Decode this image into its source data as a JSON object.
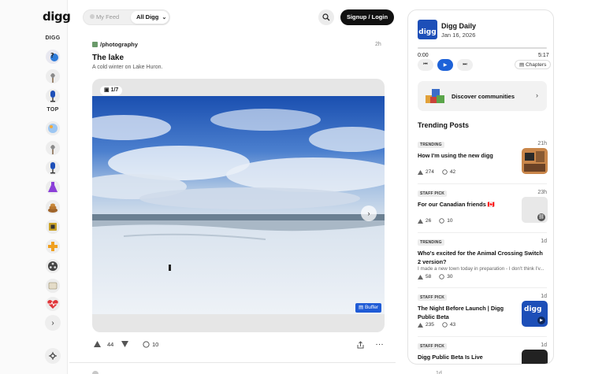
{
  "nav": {
    "logo": "digg",
    "section_digg": "DIGG",
    "section_top": "TOP"
  },
  "top": {
    "my_feed": "My Feed",
    "all_digg": "All Digg",
    "signup": "Signup / Login"
  },
  "post": {
    "community": "/photography",
    "time": "2h",
    "title": "The lake",
    "description": "A cold winter on Lake Huron.",
    "counter": "1/7",
    "buffer": "Buffer",
    "upvotes": "44",
    "comments": "10"
  },
  "next_post": {
    "time": "1d"
  },
  "podcast": {
    "title": "Digg Daily",
    "date": "Jan 16, 2026",
    "elapsed": "0:00",
    "duration": "5:17",
    "progress": 0,
    "chapters": "Chapters",
    "art_label": "digg"
  },
  "discover": {
    "label": "Discover communities"
  },
  "trending": {
    "heading": "Trending Posts",
    "items": [
      {
        "tag": "TRENDING",
        "time": "21h",
        "title": "How I'm using the new digg",
        "sub": "",
        "votes": "274",
        "comments": "42"
      },
      {
        "tag": "STAFF PICK",
        "time": "23h",
        "title": "For our Canadian friends 🇨🇦",
        "sub": "",
        "votes": "26",
        "comments": "10"
      },
      {
        "tag": "TRENDING",
        "time": "1d",
        "title": "Who's excited for the Animal Crossing Switch 2 version?",
        "sub": "I made a new town today in preparation - I don't think I'v...",
        "votes": "58",
        "comments": "30"
      },
      {
        "tag": "STAFF PICK",
        "time": "1d",
        "title": "The Night Before Launch | Digg Public Beta",
        "sub": "",
        "votes": "235",
        "comments": "43"
      },
      {
        "tag": "STAFF PICK",
        "time": "1d",
        "title": "Digg Public Beta Is Live",
        "sub": "",
        "votes": "",
        "comments": ""
      }
    ]
  },
  "colors": {
    "accent": "#1d62d8",
    "dark_button": "#111111",
    "digg_blue": "#1d4fb8"
  }
}
